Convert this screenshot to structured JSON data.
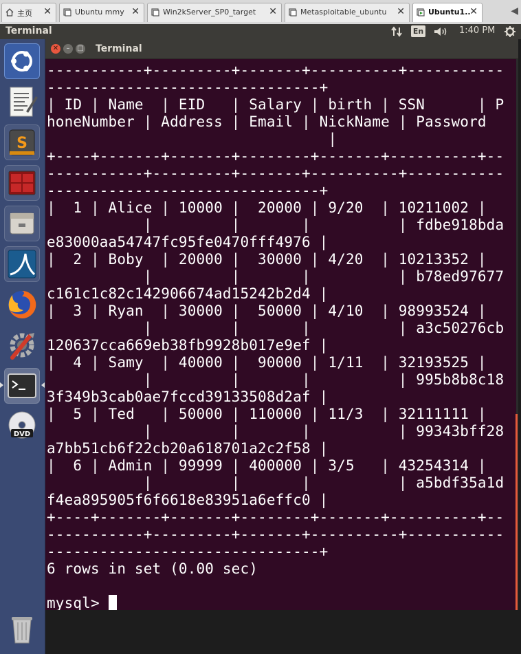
{
  "vm_tabs": [
    {
      "label": "主页",
      "icon": "home-icon",
      "active": false
    },
    {
      "label": "Ubuntu mmy",
      "icon": "vm-icon",
      "active": false
    },
    {
      "label": "Win2kServer_SP0_target",
      "icon": "vm-icon",
      "active": false
    },
    {
      "label": "Metasploitable_ubuntu",
      "icon": "vm-icon",
      "active": false
    },
    {
      "label": "Ubuntu1...",
      "icon": "vm-running-icon",
      "active": true
    }
  ],
  "top_panel": {
    "app_title": "Terminal",
    "keyboard_layout": "En",
    "clock": "1:40 PM",
    "icons": [
      "network-icon",
      "keyboard-icon",
      "volume-icon",
      "gear-icon"
    ]
  },
  "launcher": {
    "items": [
      "ubuntu-dash-icon",
      "text-editor-icon",
      "sublime-icon",
      "terminal-split-icon",
      "file-manager-icon",
      "wireshark-icon",
      "firefox-icon",
      "settings-icon",
      "terminal-icon",
      "dvd-icon",
      "trash-icon"
    ]
  },
  "window": {
    "title": "Terminal"
  },
  "terminal": {
    "lines": [
      "-----------+---------+-------+----------+-----------",
      "-------------------------------+",
      "| ID | Name  | EID   | Salary | birth | SSN      | P",
      "honeNumber | Address | Email | NickName | Password",
      "                                |",
      "+----+-------+-------+--------+-------+----------+--",
      "-----------+---------+-------+----------+-----------",
      "-------------------------------+",
      "|  1 | Alice | 10000 |  20000 | 9/20  | 10211002 |",
      "           |         |       |          | fdbe918bda",
      "e83000aa54747fc95fe0470fff4976 |",
      "|  2 | Boby  | 20000 |  30000 | 4/20  | 10213352 |",
      "           |         |       |          | b78ed97677",
      "c161c1c82c142906674ad15242b2d4 |",
      "|  3 | Ryan  | 30000 |  50000 | 4/10  | 98993524 |",
      "           |         |       |          | a3c50276cb",
      "120637cca669eb38fb9928b017e9ef |",
      "|  4 | Samy  | 40000 |  90000 | 1/11  | 32193525 |",
      "           |         |       |          | 995b8b8c18",
      "3f349b3cab0ae7fccd39133508d2af |",
      "|  5 | Ted   | 50000 | 110000 | 11/3  | 32111111 |",
      "           |         |       |          | 99343bff28",
      "a7bb51cb6f22cb20a618701a2c2f58 |",
      "|  6 | Admin | 99999 | 400000 | 3/5   | 43254314 |",
      "           |         |       |          | a5bdf35a1d",
      "f4ea895905f6f6618e83951a6effc0 |",
      "+----+-------+-------+--------+-------+----------+--",
      "-----------+---------+-------+----------+-----------",
      "-------------------------------+",
      "6 rows in set (0.00 sec)",
      ""
    ],
    "prompt": "mysql> "
  }
}
